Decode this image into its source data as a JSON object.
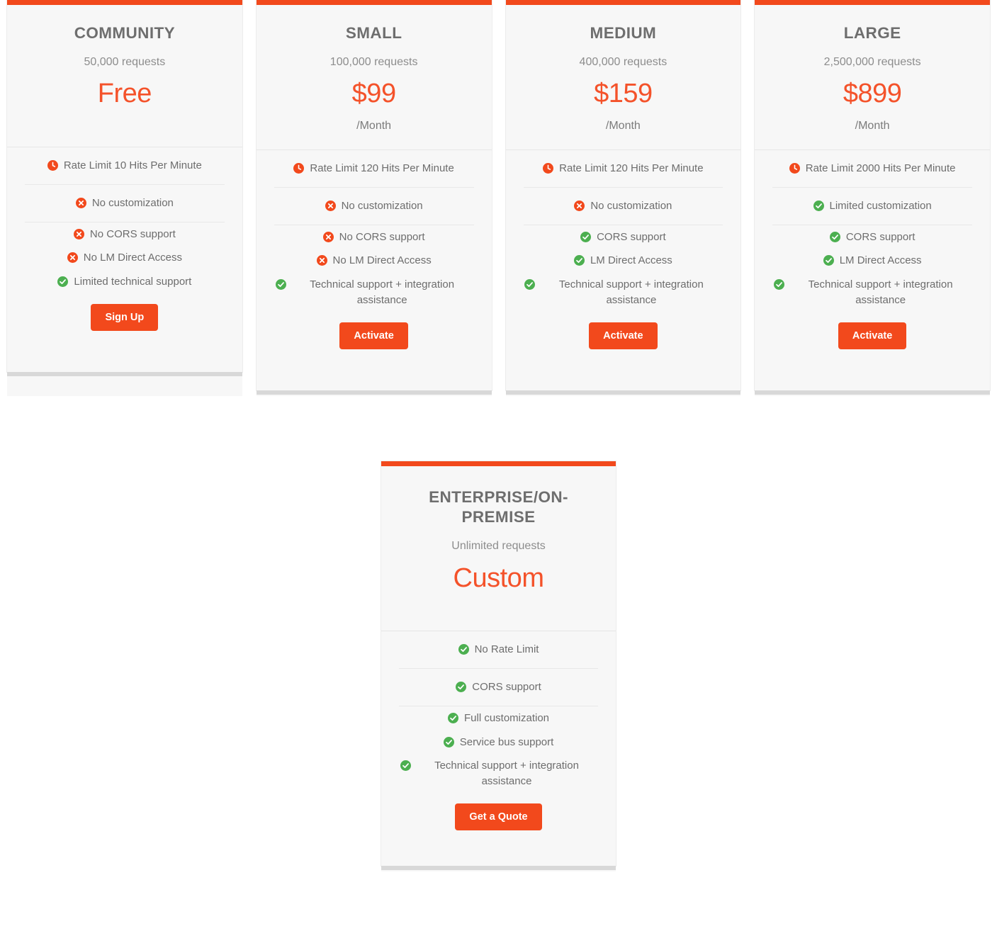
{
  "theme": {
    "accent": "#f2491c",
    "price_color": "#f4522a",
    "heading_color": "#6e6e6e",
    "text_color": "#6d6d6d",
    "card_bg": "#f7f7f7",
    "ok_color": "#4caf50",
    "no_color": "#f2491c"
  },
  "plans": [
    {
      "name": "COMMUNITY",
      "requests": "50,000 requests",
      "price": "Free",
      "period": "",
      "features": [
        {
          "icon": "clock-icon",
          "status": "limit",
          "text": "Rate Limit 10 Hits Per Minute",
          "separator": true
        },
        {
          "icon": "x-circle-icon",
          "status": "no",
          "text": "No customization",
          "separator": true
        },
        {
          "icon": "x-circle-icon",
          "status": "no",
          "text": "No CORS support",
          "separator": false
        },
        {
          "icon": "x-circle-icon",
          "status": "no",
          "text": "No LM Direct Access",
          "separator": false
        },
        {
          "icon": "check-circle-icon",
          "status": "yes",
          "text": "Limited technical support",
          "separator": false
        }
      ],
      "cta": "Sign Up"
    },
    {
      "name": "SMALL",
      "requests": "100,000 requests",
      "price": "$99",
      "period": "/Month",
      "features": [
        {
          "icon": "clock-icon",
          "status": "limit",
          "text": "Rate Limit 120 Hits Per Minute",
          "separator": true
        },
        {
          "icon": "x-circle-icon",
          "status": "no",
          "text": "No customization",
          "separator": true
        },
        {
          "icon": "x-circle-icon",
          "status": "no",
          "text": "No CORS support",
          "separator": false
        },
        {
          "icon": "x-circle-icon",
          "status": "no",
          "text": "No LM Direct Access",
          "separator": false
        },
        {
          "icon": "check-circle-icon",
          "status": "yes",
          "text": "Technical support + integration assistance",
          "separator": false
        }
      ],
      "cta": "Activate"
    },
    {
      "name": "MEDIUM",
      "requests": "400,000 requests",
      "price": "$159",
      "period": "/Month",
      "features": [
        {
          "icon": "clock-icon",
          "status": "limit",
          "text": "Rate Limit 120 Hits Per Minute",
          "separator": true
        },
        {
          "icon": "x-circle-icon",
          "status": "no",
          "text": "No customization",
          "separator": true
        },
        {
          "icon": "check-circle-icon",
          "status": "yes",
          "text": "CORS support",
          "separator": false
        },
        {
          "icon": "check-circle-icon",
          "status": "yes",
          "text": "LM Direct Access",
          "separator": false
        },
        {
          "icon": "check-circle-icon",
          "status": "yes",
          "text": "Technical support + integration assistance",
          "separator": false
        }
      ],
      "cta": "Activate"
    },
    {
      "name": "LARGE",
      "requests": "2,500,000 requests",
      "price": "$899",
      "period": "/Month",
      "features": [
        {
          "icon": "clock-icon",
          "status": "limit",
          "text": "Rate Limit 2000 Hits Per Minute",
          "separator": true
        },
        {
          "icon": "check-circle-icon",
          "status": "yes",
          "text": "Limited customization",
          "separator": true
        },
        {
          "icon": "check-circle-icon",
          "status": "yes",
          "text": "CORS support",
          "separator": false
        },
        {
          "icon": "check-circle-icon",
          "status": "yes",
          "text": "LM Direct Access",
          "separator": false
        },
        {
          "icon": "check-circle-icon",
          "status": "yes",
          "text": "Technical support + integration assistance",
          "separator": false
        }
      ],
      "cta": "Activate"
    }
  ],
  "enterprise_plan": {
    "name": "ENTERPRISE/ON-PREMISE",
    "requests": "Unlimited requests",
    "price": "Custom",
    "period": "",
    "features": [
      {
        "icon": "check-circle-icon",
        "status": "yes",
        "text": "No Rate Limit",
        "separator": true
      },
      {
        "icon": "check-circle-icon",
        "status": "yes",
        "text": "CORS support",
        "separator": true
      },
      {
        "icon": "check-circle-icon",
        "status": "yes",
        "text": "Full customization",
        "separator": false
      },
      {
        "icon": "check-circle-icon",
        "status": "yes",
        "text": "Service bus support",
        "separator": false
      },
      {
        "icon": "check-circle-icon",
        "status": "yes",
        "text": "Technical support + integration assistance",
        "separator": false
      }
    ],
    "cta": "Get a Quote"
  }
}
